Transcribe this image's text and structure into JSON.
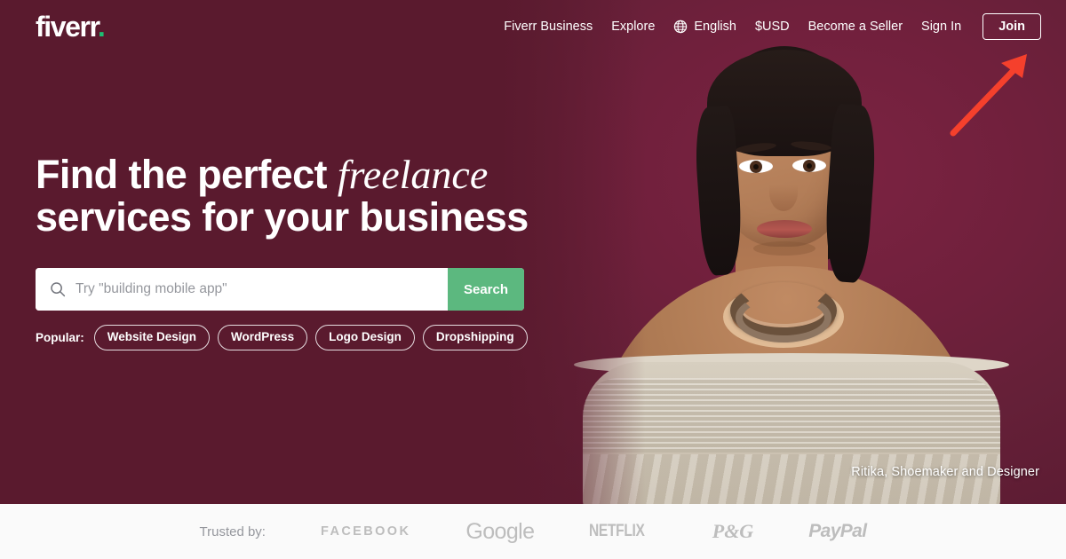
{
  "site": {
    "logo_text": "fiverr",
    "logo_dot": "."
  },
  "colors": {
    "hero_background": "#5a1a2e",
    "photo_backdrop": "#74213f",
    "accent_green": "#1dbf73",
    "search_button_green": "#5cb87f",
    "annotation_red": "#f5402c",
    "trusted_bar_background": "#fafafa",
    "brand_logo_gray": "#bdbdbd"
  },
  "header": {
    "nav": [
      {
        "label": "Fiverr Business",
        "name": "fiverr-business"
      },
      {
        "label": "Explore",
        "name": "explore"
      },
      {
        "label": "English",
        "name": "language",
        "icon": "globe-icon"
      },
      {
        "label": "$USD",
        "name": "currency"
      },
      {
        "label": "Become a Seller",
        "name": "become-a-seller"
      },
      {
        "label": "Sign In",
        "name": "sign-in"
      }
    ],
    "join_label": "Join"
  },
  "hero": {
    "headline_part1": "Find the perfect ",
    "headline_emphasis": "freelance",
    "headline_part2": "services for your business",
    "search": {
      "placeholder": "Try \"building mobile app\"",
      "value": "",
      "button_label": "Search",
      "icon": "search-icon"
    },
    "popular": {
      "label": "Popular:",
      "tags": [
        {
          "label": "Website Design"
        },
        {
          "label": "WordPress"
        },
        {
          "label": "Logo Design"
        },
        {
          "label": "Dropshipping"
        }
      ]
    },
    "photo_caption": "Ritika, Shoemaker and Designer"
  },
  "annotation": {
    "type": "arrow",
    "points_to": "join-button",
    "color": "#f5402c"
  },
  "trusted": {
    "label": "Trusted by:",
    "brands": [
      {
        "label": "FACEBOOK",
        "name": "facebook"
      },
      {
        "label": "Google",
        "name": "google"
      },
      {
        "label": "NETFLIX",
        "name": "netflix"
      },
      {
        "label": "P&G",
        "name": "pg"
      },
      {
        "label": "PayPal",
        "name": "paypal"
      }
    ]
  }
}
